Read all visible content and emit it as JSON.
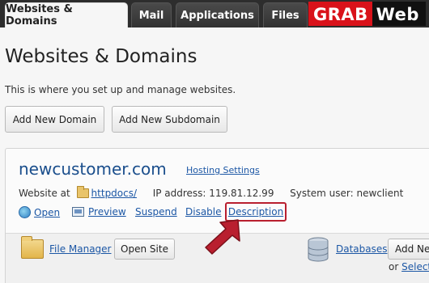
{
  "tabs": [
    {
      "label": "Websites & Domains",
      "active": true
    },
    {
      "label": "Mail",
      "active": false
    },
    {
      "label": "Applications",
      "active": false
    },
    {
      "label": "Files",
      "active": false
    }
  ],
  "brand": {
    "part1": "GRAB",
    "part2": "Web",
    "accent": "#d9121a"
  },
  "page": {
    "title": "Websites & Domains",
    "description": "This is where you set up and manage websites.",
    "add_domain_label": "Add New Domain",
    "add_subdomain_label": "Add New Subdomain"
  },
  "domain": {
    "name": "newcustomer.com",
    "hosting_settings_label": "Hosting Settings",
    "website_at_label": "Website at",
    "docroot": "httpdocs/",
    "ip_label": "IP address:",
    "ip": "119.81.12.99",
    "sysuser_label": "System user:",
    "sysuser": "newclient",
    "actions": {
      "open": "Open",
      "preview": "Preview",
      "suspend": "Suspend",
      "disable": "Disable",
      "description": "Description"
    }
  },
  "tools": {
    "file_manager": "File Manager",
    "open_site": "Open Site",
    "databases": "Databases",
    "add_new": "Add Ne",
    "or_label": "or",
    "select": "Select"
  },
  "colors": {
    "link": "#1c57a5",
    "highlight": "#b91f2f",
    "tabbar": "#2d2d2d"
  }
}
